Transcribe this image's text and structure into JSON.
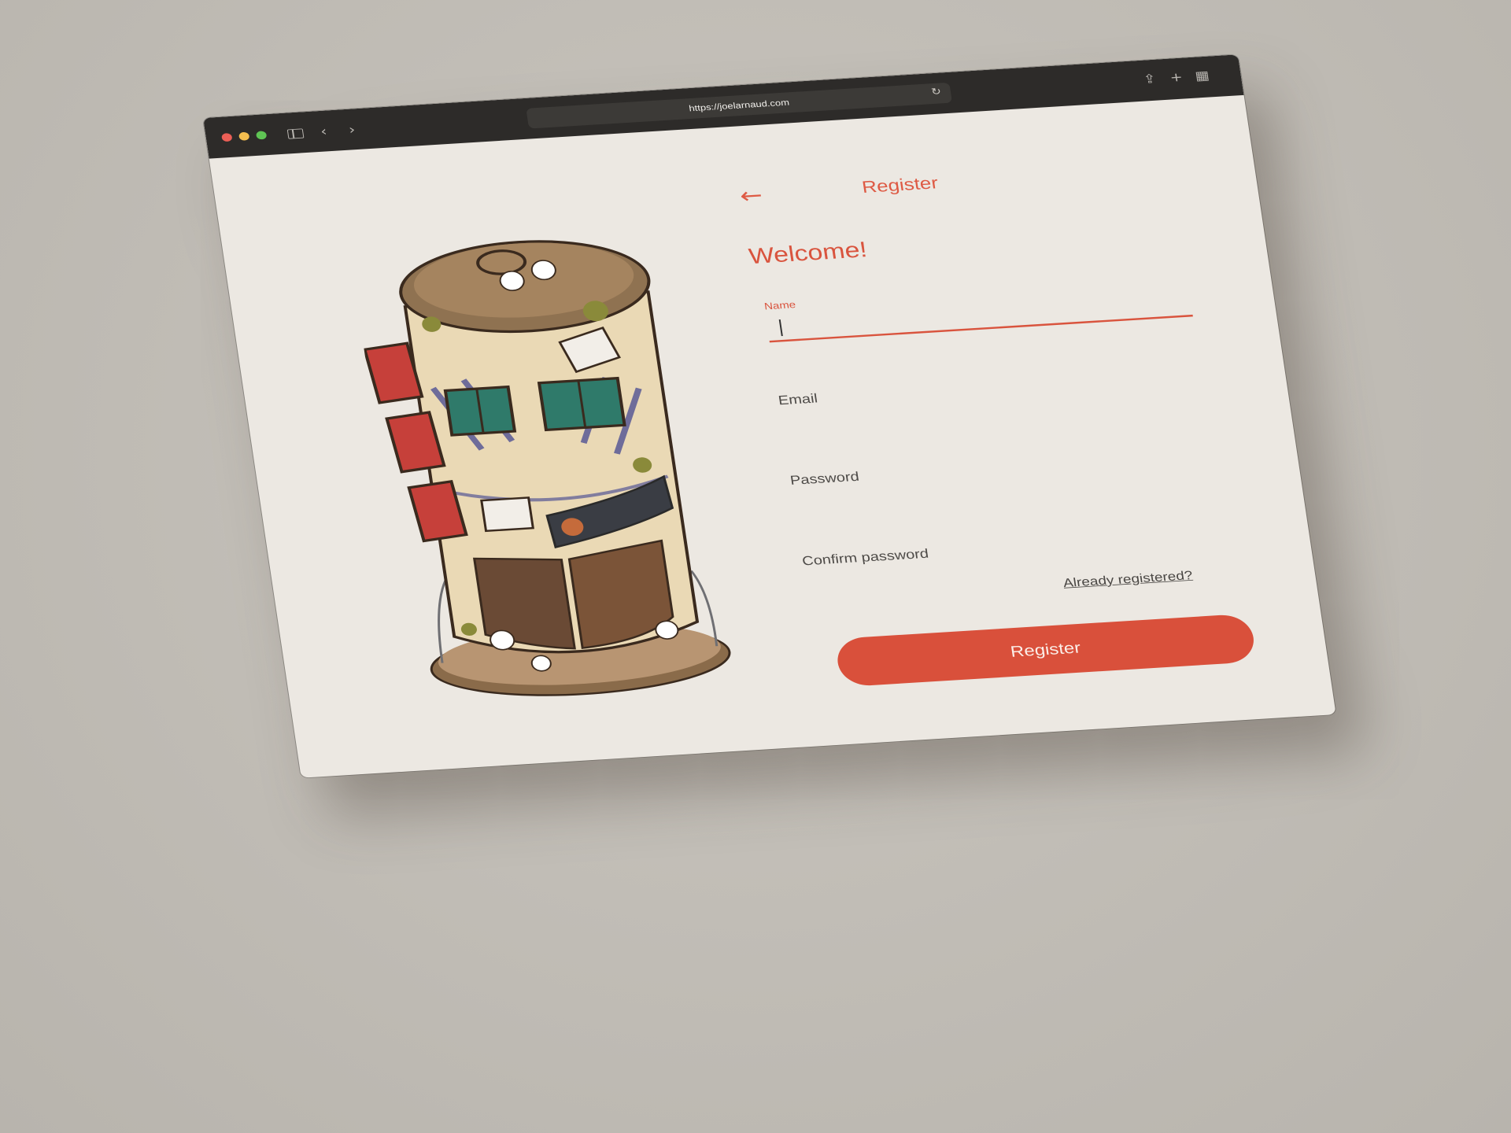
{
  "browser": {
    "url": "https://joelarnaud.com",
    "controls": {
      "back_icon": "chevron-left-icon",
      "forward_icon": "chevron-right-icon",
      "reload_icon": "reload-icon",
      "share_icon": "share-icon",
      "new_tab_icon": "plus-icon",
      "tabs_overview_icon": "grid-icon"
    }
  },
  "header": {
    "title": "Register",
    "back_icon": "arrow-left-icon"
  },
  "form": {
    "greeting": "Welcome!",
    "fields": [
      {
        "label": "Name",
        "value": "",
        "focused": true
      },
      {
        "label": "Email",
        "value": ""
      },
      {
        "label": "Password",
        "value": ""
      },
      {
        "label": "Confirm password",
        "value": ""
      }
    ],
    "login_link": "Already registered?",
    "submit_label": "Register"
  },
  "colors": {
    "accent": "#d9503b",
    "page_background": "#ece8e2",
    "toolbar": "#2d2b29"
  }
}
